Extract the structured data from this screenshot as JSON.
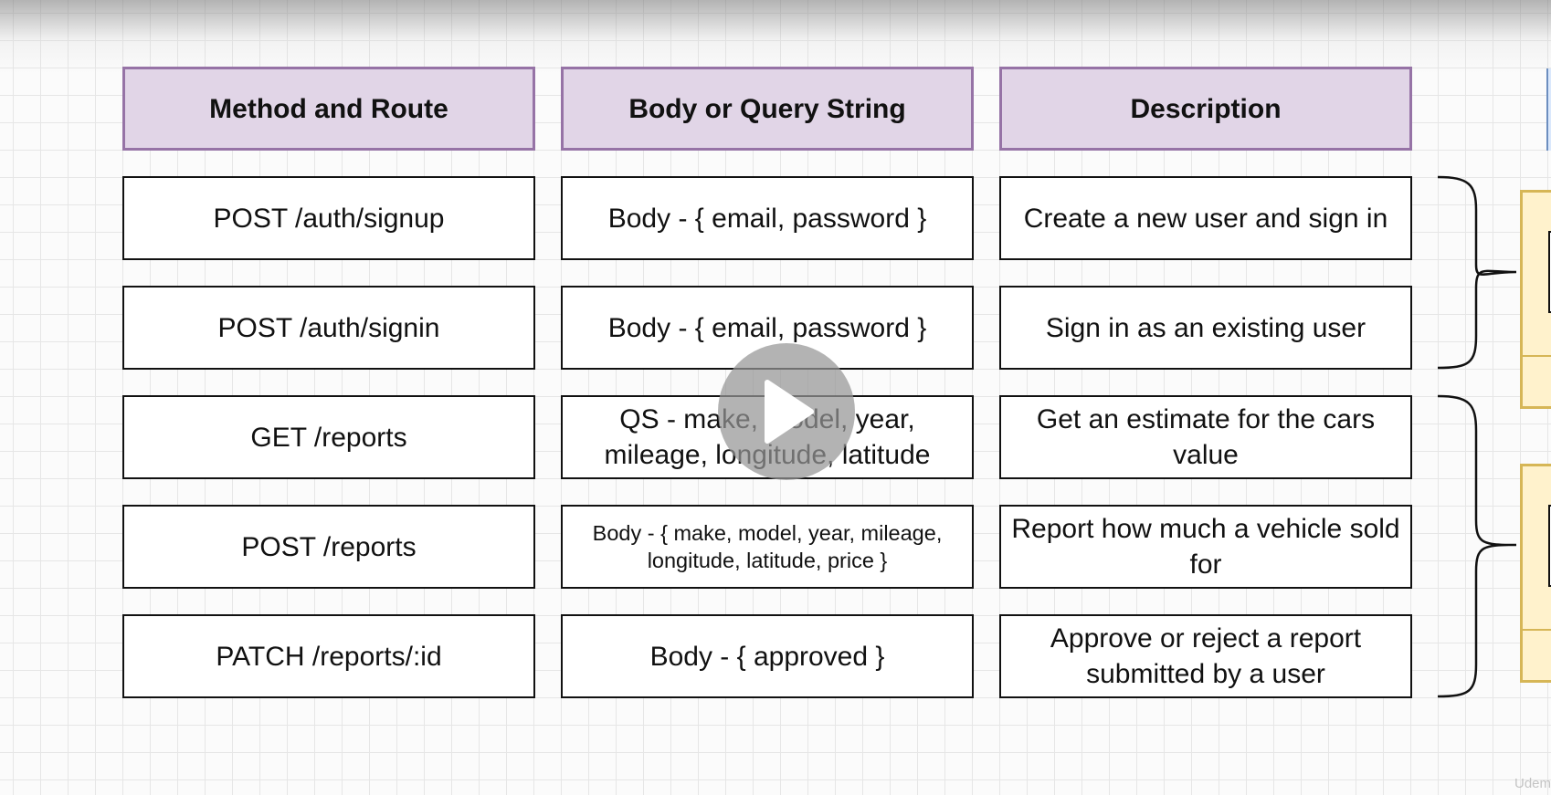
{
  "table": {
    "headers": {
      "method": "Method and Route",
      "body": "Body or Query String",
      "description": "Description"
    },
    "rows": [
      {
        "method": "POST /auth/signup",
        "body": "Body - { email, password }",
        "description": "Create a new user and sign in"
      },
      {
        "method": "POST /auth/signin",
        "body": "Body - { email, password }",
        "description": "Sign in as an existing user"
      },
      {
        "method": "GET /reports",
        "body": "QS - make, model, year, mileage, longitude, latitude",
        "description": "Get an estimate for the cars value"
      },
      {
        "method": "POST /reports",
        "body": "Body - { make, model, year, mileage, longitude, latitude, price }",
        "description": "Report how much a vehicle sold for"
      },
      {
        "method": "PATCH /reports/:id",
        "body": "Body - { approved }",
        "description": "Approve or reject a report submitted by a user"
      }
    ]
  },
  "overlay": {
    "play_icon": "play-icon",
    "watermark": "Udem"
  },
  "colors": {
    "header_fill": "#e1d5e7",
    "header_border": "#9673a6",
    "side_panel_fill": "#fff2cc",
    "side_panel_border": "#d6b656",
    "grid_line": "#e6e6e6"
  }
}
